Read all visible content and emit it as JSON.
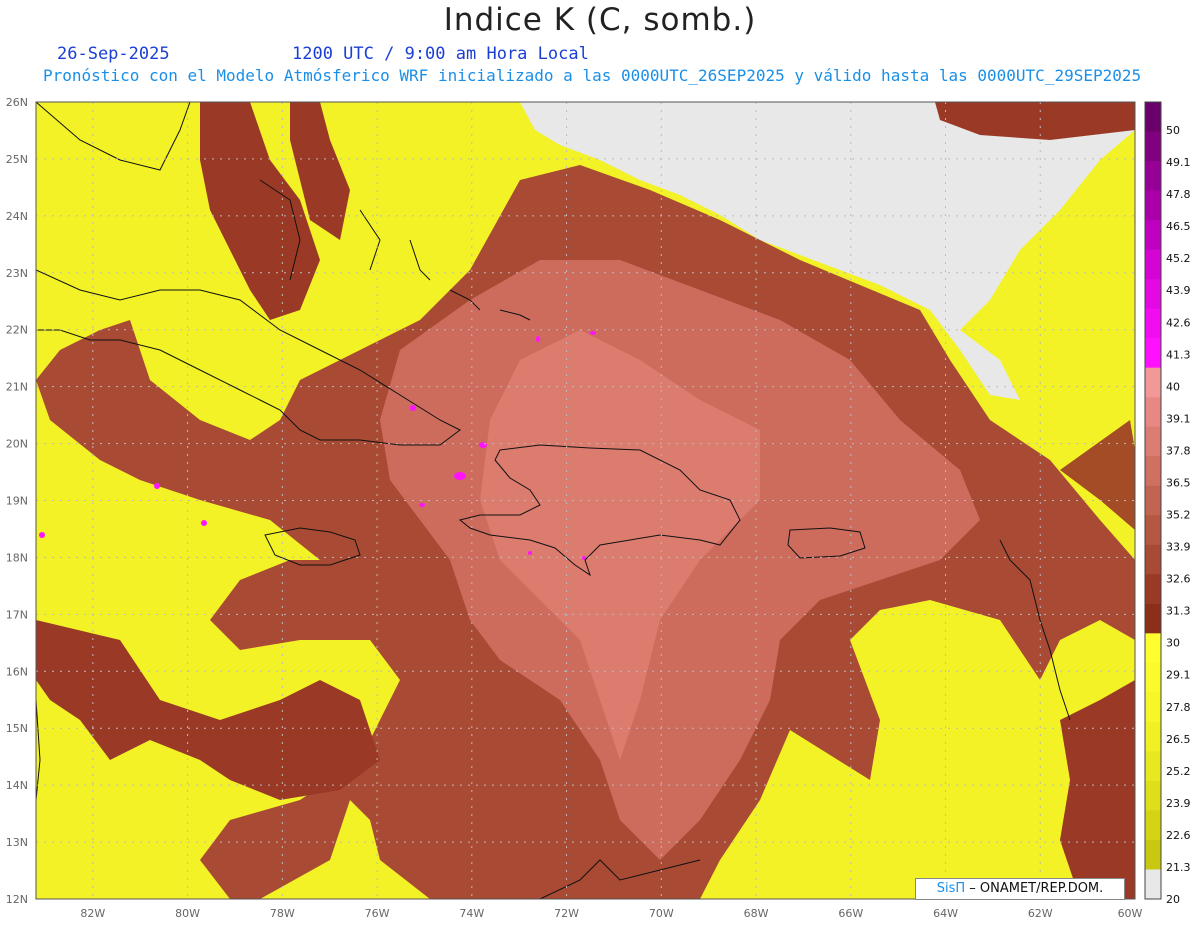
{
  "header": {
    "title": "Indice K (C, somb.)",
    "date": "26-Sep-2025",
    "time": "1200 UTC / 9:00 am Hora Local",
    "subtitle": "Pronóstico con el Modelo Atmósferico WRF inicializado a las 0000UTC_26SEP2025 y válido hasta las  0000UTC_29SEP2025"
  },
  "map": {
    "latitudes": [
      "26N",
      "25N",
      "24N",
      "23N",
      "22N",
      "21N",
      "20N",
      "19N",
      "18N",
      "17N",
      "16N",
      "15N",
      "14N",
      "13N",
      "12N"
    ],
    "longitudes": [
      "82W",
      "80W",
      "78W",
      "76W",
      "74W",
      "72W",
      "70W",
      "68W",
      "66W",
      "64W",
      "62W",
      "60W"
    ],
    "lat_range": [
      12,
      26
    ],
    "lon_range": [
      -83.2,
      -60
    ],
    "grid": true
  },
  "colorbar": {
    "labels": [
      "50",
      "49.1",
      "47.8",
      "46.5",
      "45.2",
      "43.9",
      "42.6",
      "41.3",
      "40",
      "39.1",
      "37.8",
      "36.5",
      "35.2",
      "33.9",
      "32.6",
      "31.3",
      "30",
      "29.1",
      "27.8",
      "26.5",
      "25.2",
      "23.9",
      "22.6",
      "21.3",
      "20"
    ],
    "colors": {
      "below_20": "#e8e8e8",
      "yellow_band": [
        "#c8c810",
        "#d4d414",
        "#dede1a",
        "#e8e820",
        "#f0f024",
        "#f6f628",
        "#fafa2c",
        "#ffff30"
      ],
      "red_band": [
        "#8b2e1a",
        "#9a3a26",
        "#a84a34",
        "#b55842",
        "#c26452",
        "#cf7062",
        "#dc7c72",
        "#e88884",
        "#f29898"
      ],
      "magenta_band": [
        "#ff10ff",
        "#f20cf2",
        "#e408e4",
        "#d404d4",
        "#c000c0",
        "#aa00aa",
        "#960096",
        "#800080",
        "#6a006a"
      ]
    }
  },
  "credit": {
    "brand": "SisΠ",
    "text": "– ONAMET/REP.DOM."
  }
}
